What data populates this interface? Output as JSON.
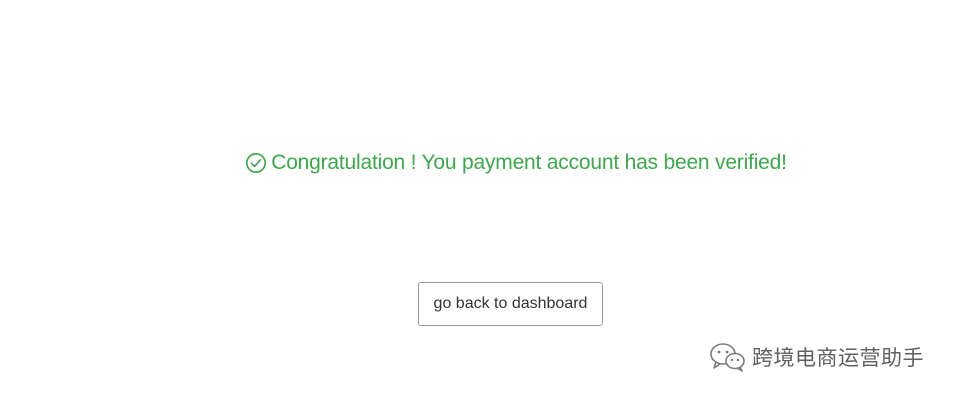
{
  "message": {
    "text": "Congratulation ! You payment account has been verified!",
    "icon": "check-circle-icon",
    "color": "#3aaa4a"
  },
  "actions": {
    "dashboard_label": "go back to dashboard"
  },
  "watermark": {
    "icon": "wechat-icon",
    "text": "跨境电商运营助手"
  }
}
